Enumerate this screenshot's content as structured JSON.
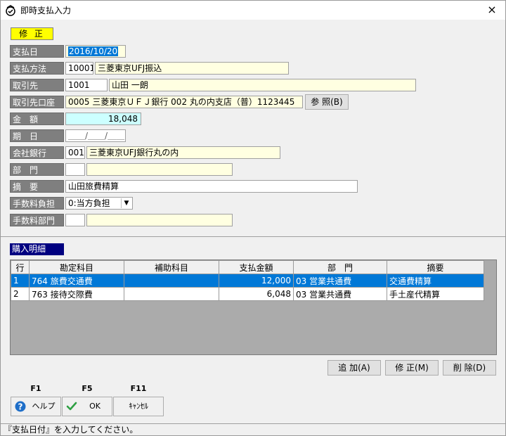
{
  "window": {
    "title": "即時支払入力",
    "close_label": "×"
  },
  "mode_badge": "修 正",
  "form": {
    "pay_date": {
      "label": "支払日",
      "value": "2016/10/20"
    },
    "pay_method": {
      "label": "支払方法",
      "code": "10001",
      "name": "三菱東京UFJ振込"
    },
    "payee": {
      "label": "取引先",
      "code": "1001",
      "name": "山田 一朗"
    },
    "payee_account": {
      "label": "取引先口座",
      "value": "0005 三菱東京ＵＦＪ銀行 002 丸の内支店（普）1123445",
      "ref_button": "参 照(B)"
    },
    "amount": {
      "label": "金　額",
      "value": "18,048"
    },
    "due_date": {
      "label": "期　日",
      "value": "＿＿/＿＿/＿＿"
    },
    "company_bank": {
      "label": "会社銀行",
      "code": "001",
      "name": "三菱東京UFJ銀行丸の内"
    },
    "department": {
      "label": "部　門",
      "code": "",
      "name": ""
    },
    "memo": {
      "label": "摘　要",
      "value": "山田旅費精算"
    },
    "fee_burden": {
      "label": "手数料負担",
      "value": "0:当方負担"
    },
    "fee_department": {
      "label": "手数料部門",
      "code": "",
      "name": ""
    }
  },
  "detail": {
    "section_label": "購入明細",
    "columns": [
      "行",
      "勘定科目",
      "補助科目",
      "支払金額",
      "部　門",
      "摘要"
    ],
    "rows": [
      {
        "line": "1",
        "acct_code": "764",
        "acct_name": "旅費交通費",
        "sub": "",
        "amount": "12,000",
        "dept_code": "03",
        "dept_name": "営業共通費",
        "memo": "交通費精算",
        "selected": true
      },
      {
        "line": "2",
        "acct_code": "763",
        "acct_name": "接待交際費",
        "sub": "",
        "amount": "6,048",
        "dept_code": "03",
        "dept_name": "営業共通費",
        "memo": "手土産代精算",
        "selected": false
      }
    ],
    "buttons": {
      "add": "追 加(A)",
      "edit": "修 正(M)",
      "delete": "削 除(D)"
    }
  },
  "fkeys": [
    {
      "key": "F1",
      "label": "ヘルプ",
      "icon": "help-icon"
    },
    {
      "key": "F5",
      "label": "OK",
      "icon": "check-icon"
    },
    {
      "key": "F11",
      "label": "ｷｬﾝｾﾙ",
      "icon": ""
    }
  ],
  "status": "『支払日付』を入力してください。"
}
